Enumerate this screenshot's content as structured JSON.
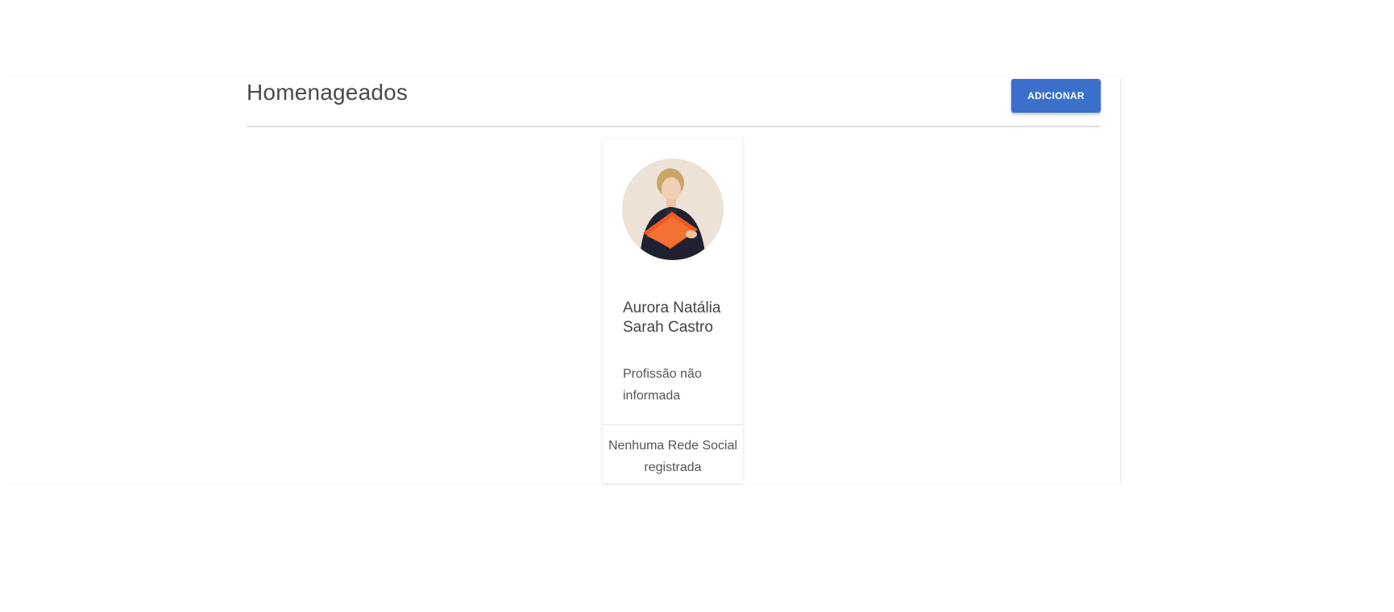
{
  "page": {
    "title": "Homenageados",
    "add_button_label": "ADICIONAR"
  },
  "honorees": [
    {
      "name": "Aurora Natália Sarah Castro",
      "profession": "Profissão não informada",
      "social": "Nenhuma Rede Social registrada",
      "photo_icon": "portrait-photo"
    }
  ],
  "colors": {
    "accent": "#3a6fcc",
    "text": "#4a4a4a",
    "divider": "#dedede"
  }
}
